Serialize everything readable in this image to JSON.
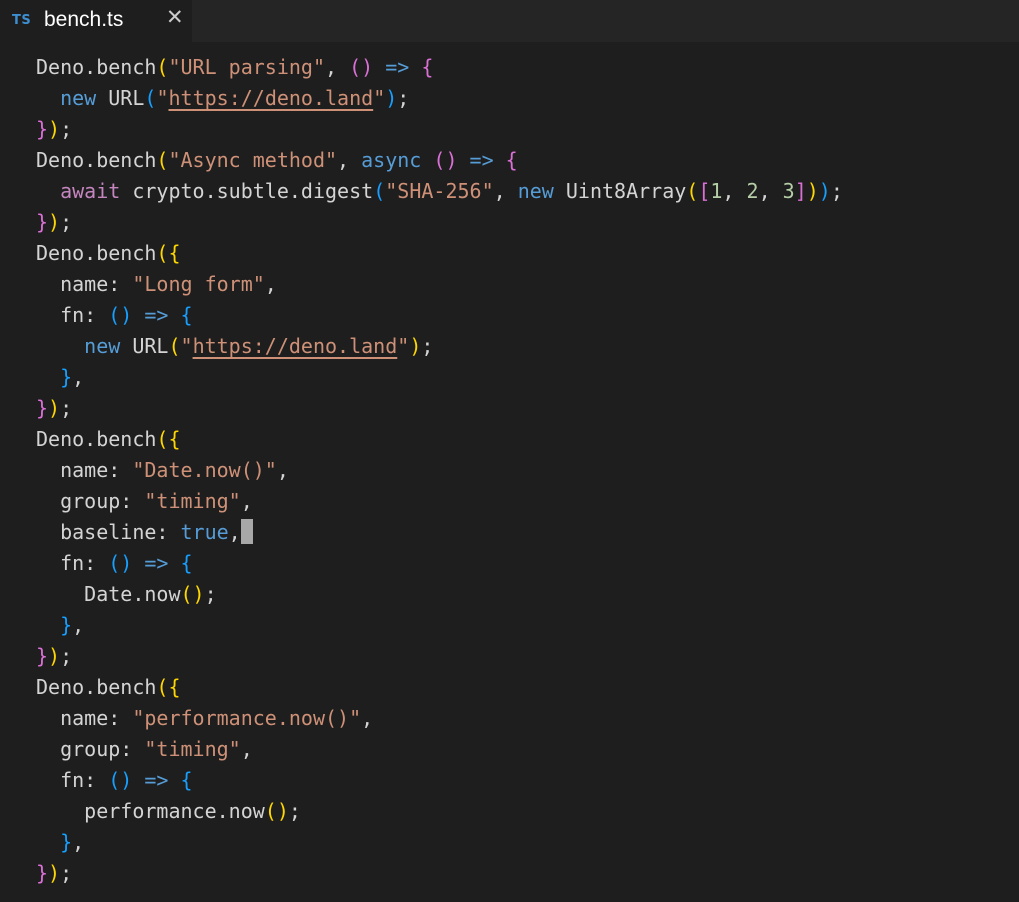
{
  "colors": {
    "background": "#1e1e1e",
    "tabbar": "#252526",
    "text": "#d4d4d4",
    "string": "#ce9178",
    "keyword": "#569cd6",
    "control": "#c586c0",
    "number": "#b5cea8",
    "bracket_1": "#ffd700",
    "bracket_2": "#da70d6",
    "bracket_3": "#179fff",
    "ts_icon": "#3d8fd1",
    "cursor": "#a8a8a8"
  },
  "tab": {
    "language_badge": "TS",
    "filename": "bench.ts",
    "close_icon": "✕",
    "icons": {
      "language": "typescript-icon",
      "close": "close-icon"
    }
  },
  "editor": {
    "cursor_line": 15,
    "lines": [
      [
        [
          "Deno.bench",
          "default"
        ],
        [
          "(",
          "b1"
        ],
        [
          "\"URL parsing\"",
          "str"
        ],
        [
          ", ",
          "default"
        ],
        [
          "()",
          "b2"
        ],
        [
          " => ",
          "kw"
        ],
        [
          "{",
          "b2"
        ]
      ],
      [
        [
          "  ",
          "default"
        ],
        [
          "new",
          "kw"
        ],
        [
          " URL",
          "default"
        ],
        [
          "(",
          "b3"
        ],
        [
          "\"",
          "str"
        ],
        [
          "https://deno.land",
          "link"
        ],
        [
          "\"",
          "str"
        ],
        [
          ")",
          "b3"
        ],
        [
          ";",
          "default"
        ]
      ],
      [
        [
          "}",
          "b2"
        ],
        [
          ")",
          "b1"
        ],
        [
          ";",
          "default"
        ]
      ],
      [
        [
          "Deno.bench",
          "default"
        ],
        [
          "(",
          "b1"
        ],
        [
          "\"Async method\"",
          "str"
        ],
        [
          ", ",
          "default"
        ],
        [
          "async",
          "kw"
        ],
        [
          " ",
          "default"
        ],
        [
          "()",
          "b2"
        ],
        [
          " => ",
          "kw"
        ],
        [
          "{",
          "b2"
        ]
      ],
      [
        [
          "  ",
          "default"
        ],
        [
          "await",
          "ctl"
        ],
        [
          " crypto.subtle.digest",
          "default"
        ],
        [
          "(",
          "b3"
        ],
        [
          "\"SHA-256\"",
          "str"
        ],
        [
          ", ",
          "default"
        ],
        [
          "new",
          "kw"
        ],
        [
          " Uint8Array",
          "default"
        ],
        [
          "(",
          "b1"
        ],
        [
          "[",
          "b2"
        ],
        [
          "1",
          "num"
        ],
        [
          ", ",
          "default"
        ],
        [
          "2",
          "num"
        ],
        [
          ", ",
          "default"
        ],
        [
          "3",
          "num"
        ],
        [
          "]",
          "b2"
        ],
        [
          ")",
          "b1"
        ],
        [
          ")",
          "b3"
        ],
        [
          ";",
          "default"
        ]
      ],
      [
        [
          "}",
          "b2"
        ],
        [
          ")",
          "b1"
        ],
        [
          ";",
          "default"
        ]
      ],
      [
        [
          "Deno.bench",
          "default"
        ],
        [
          "({",
          "b1"
        ]
      ],
      [
        [
          "  name: ",
          "default"
        ],
        [
          "\"Long form\"",
          "str"
        ],
        [
          ",",
          "default"
        ]
      ],
      [
        [
          "  fn: ",
          "default"
        ],
        [
          "()",
          "b3"
        ],
        [
          " => ",
          "kw"
        ],
        [
          "{",
          "b3"
        ]
      ],
      [
        [
          "    ",
          "default"
        ],
        [
          "new",
          "kw"
        ],
        [
          " URL",
          "default"
        ],
        [
          "(",
          "b1"
        ],
        [
          "\"",
          "str"
        ],
        [
          "https://deno.land",
          "link"
        ],
        [
          "\"",
          "str"
        ],
        [
          ")",
          "b1"
        ],
        [
          ";",
          "default"
        ]
      ],
      [
        [
          "  ",
          "default"
        ],
        [
          "}",
          "b3"
        ],
        [
          ",",
          "default"
        ]
      ],
      [
        [
          "}",
          "b2"
        ],
        [
          ")",
          "b1"
        ],
        [
          ";",
          "default"
        ]
      ],
      [
        [
          "Deno.bench",
          "default"
        ],
        [
          "({",
          "b1"
        ]
      ],
      [
        [
          "  name: ",
          "default"
        ],
        [
          "\"Date.now()\"",
          "str"
        ],
        [
          ",",
          "default"
        ]
      ],
      [
        [
          "  group: ",
          "default"
        ],
        [
          "\"timing\"",
          "str"
        ],
        [
          ",",
          "default"
        ]
      ],
      [
        [
          "  baseline: ",
          "default"
        ],
        [
          "true",
          "kw"
        ],
        [
          ",",
          "default"
        ]
      ],
      [
        [
          "  fn: ",
          "default"
        ],
        [
          "()",
          "b3"
        ],
        [
          " => ",
          "kw"
        ],
        [
          "{",
          "b3"
        ]
      ],
      [
        [
          "    Date.now",
          "default"
        ],
        [
          "()",
          "b1"
        ],
        [
          ";",
          "default"
        ]
      ],
      [
        [
          "  ",
          "default"
        ],
        [
          "}",
          "b3"
        ],
        [
          ",",
          "default"
        ]
      ],
      [
        [
          "}",
          "b2"
        ],
        [
          ")",
          "b1"
        ],
        [
          ";",
          "default"
        ]
      ],
      [
        [
          "Deno.bench",
          "default"
        ],
        [
          "({",
          "b1"
        ]
      ],
      [
        [
          "  name: ",
          "default"
        ],
        [
          "\"performance.now()\"",
          "str"
        ],
        [
          ",",
          "default"
        ]
      ],
      [
        [
          "  group: ",
          "default"
        ],
        [
          "\"timing\"",
          "str"
        ],
        [
          ",",
          "default"
        ]
      ],
      [
        [
          "  fn: ",
          "default"
        ],
        [
          "()",
          "b3"
        ],
        [
          " => ",
          "kw"
        ],
        [
          "{",
          "b3"
        ]
      ],
      [
        [
          "    performance.now",
          "default"
        ],
        [
          "()",
          "b1"
        ],
        [
          ";",
          "default"
        ]
      ],
      [
        [
          "  ",
          "default"
        ],
        [
          "}",
          "b3"
        ],
        [
          ",",
          "default"
        ]
      ],
      [
        [
          "}",
          "b2"
        ],
        [
          ")",
          "b1"
        ],
        [
          ";",
          "default"
        ]
      ]
    ]
  }
}
